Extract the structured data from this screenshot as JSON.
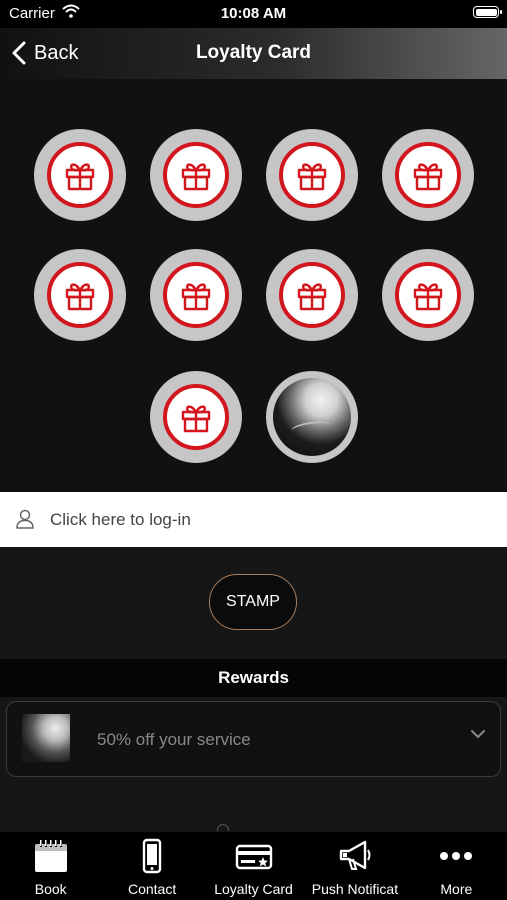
{
  "status_bar": {
    "carrier": "Carrier",
    "time": "10:08 AM"
  },
  "nav": {
    "back_label": "Back",
    "title": "Loyalty Card"
  },
  "stamps": {
    "gift_icon": "gift-icon",
    "accent_color": "#d2161d",
    "ring_color": "#c6c6c6",
    "items": [
      "gift",
      "gift",
      "gift",
      "gift",
      "gift",
      "gift",
      "gift",
      "gift",
      "gift",
      "photo"
    ]
  },
  "login": {
    "text": "Click here to log-in"
  },
  "stamp_button": {
    "label": "STAMP"
  },
  "rewards": {
    "title": "Rewards",
    "items": [
      {
        "text": "50% off your service"
      }
    ]
  },
  "tabbar": {
    "tabs": [
      {
        "label": "Book",
        "icon": "calendar-icon"
      },
      {
        "label": "Contact",
        "icon": "phone-icon"
      },
      {
        "label": "Loyalty Card",
        "icon": "loyalty-card-icon"
      },
      {
        "label": "Push Notificat",
        "icon": "megaphone-icon"
      },
      {
        "label": "More",
        "icon": "more-dots-icon"
      }
    ]
  }
}
